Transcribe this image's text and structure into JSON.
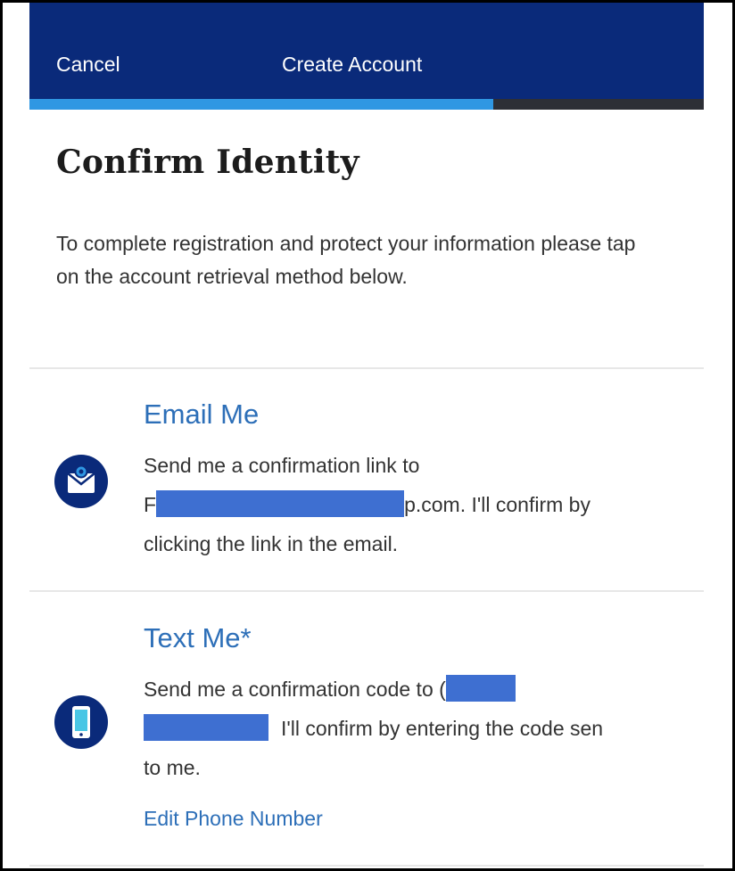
{
  "header": {
    "cancel_label": "Cancel",
    "title": "Create Account",
    "progress_fraction": 0.688,
    "bar_color": "#0a2a7a",
    "progress_color": "#2f97e3"
  },
  "page": {
    "heading": "Confirm Identity",
    "intro": "To complete registration and protect your information please tap on the account retrieval method below."
  },
  "options": {
    "email": {
      "icon": "envelope-icon",
      "title": "Email Me",
      "line1": "Send me a confirmation link to",
      "line2_prefix": "F",
      "line2_suffix": "p.com. I'll confirm by",
      "line3": "clicking the link in the email."
    },
    "text": {
      "icon": "smartphone-icon",
      "title": "Text Me*",
      "line1": "Send me a confirmation code to (",
      "line2_suffix": "I'll confirm by entering the code sen",
      "line3": "to me.",
      "edit_label": "Edit Phone Number"
    }
  },
  "colors": {
    "link": "#2d6fb8",
    "redaction": "#3e6fd1"
  }
}
